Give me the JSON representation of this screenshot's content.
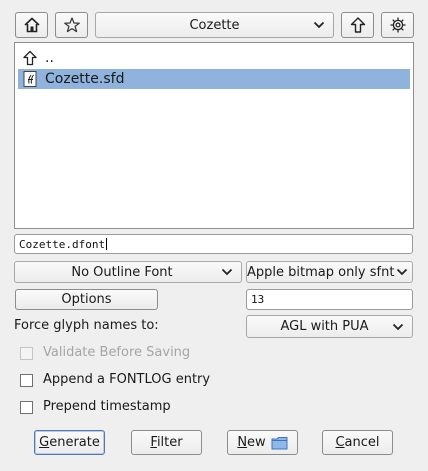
{
  "toolbar": {
    "home_icon": "home-icon",
    "star_icon": "star-icon",
    "directory_selected": "Cozette",
    "up_icon": "up-arrow-icon",
    "settings_icon": "gear-icon"
  },
  "file_list": {
    "items": [
      {
        "name": "..",
        "icon": "up-arrow-icon",
        "selected": false
      },
      {
        "name": "Cozette.sfd",
        "icon": "font-file-icon",
        "selected": true
      }
    ]
  },
  "filename_input": {
    "value": "Cozette.dfont"
  },
  "outline_format": {
    "selected": "No Outline Font"
  },
  "bitmap_format": {
    "selected": "Apple bitmap only sfnt"
  },
  "options_button": {
    "label": "Options"
  },
  "bitmap_sizes": {
    "value": "13"
  },
  "glyph_names": {
    "label": "Force glyph names to:",
    "selected": "AGL with PUA"
  },
  "checkboxes": {
    "validate": {
      "label": "Validate Before Saving",
      "checked": false,
      "enabled": false
    },
    "fontlog": {
      "label": "Append a FONTLOG entry",
      "checked": false,
      "enabled": true
    },
    "timestamp": {
      "label": "Prepend timestamp",
      "checked": false,
      "enabled": true
    }
  },
  "buttons": {
    "generate_accel": "G",
    "generate_rest": "enerate",
    "filter_accel": "F",
    "filter_rest": "ilter",
    "new_accel": "N",
    "new_rest": "ew",
    "cancel_accel": "C",
    "cancel_rest": "ancel"
  },
  "colors": {
    "selection": "#8fb3dd",
    "background": "#efefef",
    "folder_icon": "#5a8fd0"
  }
}
